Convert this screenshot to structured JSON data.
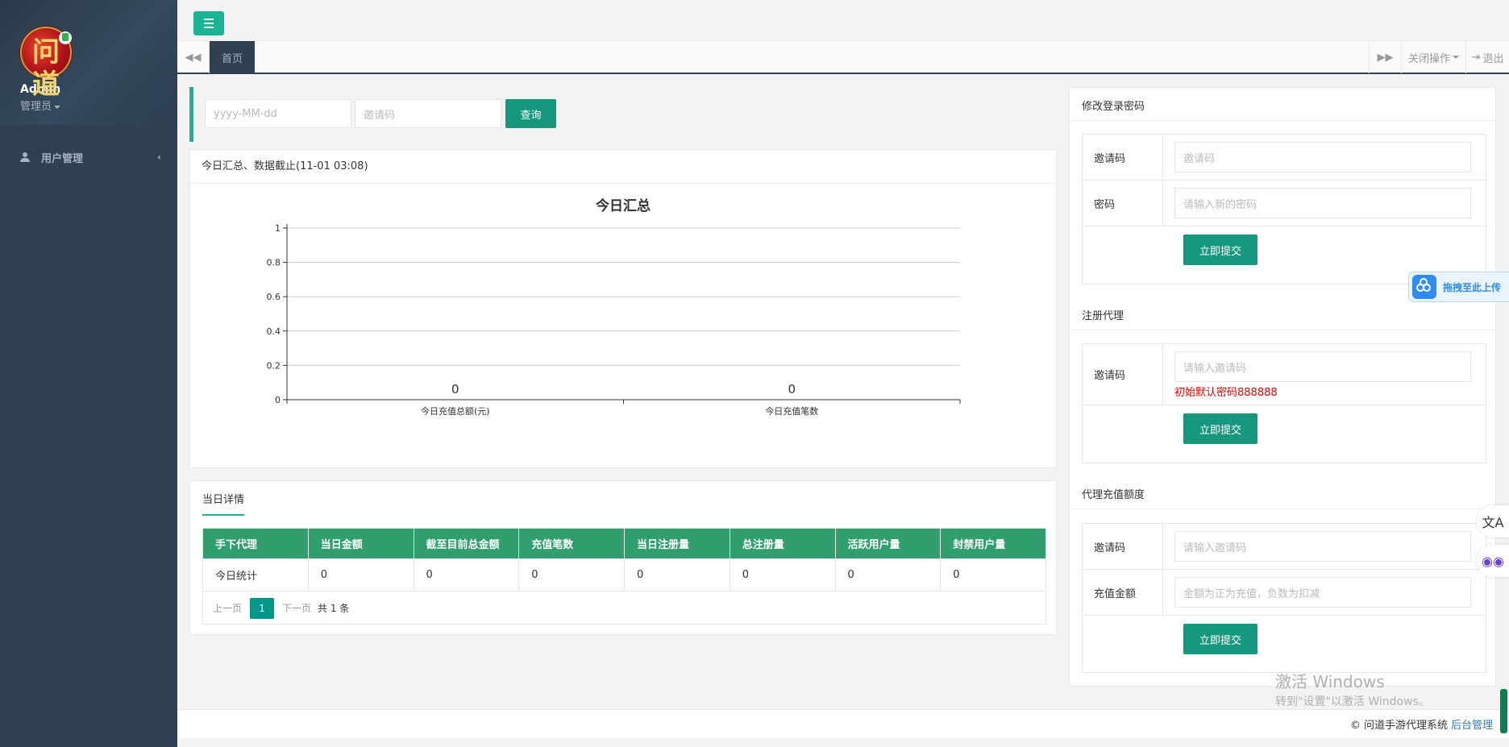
{
  "sidebar": {
    "user": {
      "name": "Admin",
      "role": "管理员",
      "avatar_text": "问道"
    },
    "items": [
      {
        "label": "用户管理",
        "icon": "user-icon"
      }
    ]
  },
  "tabs": {
    "home": "首页",
    "close_ops": "关闭操作",
    "logout": "退出"
  },
  "search": {
    "date_placeholder": "yyyy-MM-dd",
    "code_placeholder": "邀请码",
    "query_label": "查询"
  },
  "summary": {
    "panel_title": "今日汇总、数据截止(11-01 03:08)",
    "chart_title": "今日汇总"
  },
  "chart_data": {
    "type": "bar",
    "title": "今日汇总",
    "categories": [
      "今日充值总额(元)",
      "今日充值笔数"
    ],
    "values": [
      0,
      0
    ],
    "ylim": [
      0,
      1
    ],
    "yticks": [
      "0",
      "0.2",
      "0.4",
      "0.6",
      "0.8",
      "1"
    ],
    "grid": true
  },
  "details": {
    "tab_label": "当日详情",
    "columns": [
      "手下代理",
      "当日金额",
      "截至目前总金额",
      "充值笔数",
      "当日注册量",
      "总注册量",
      "活跃用户量",
      "封禁用户量"
    ],
    "rows": [
      [
        "今日统计",
        "0",
        "0",
        "0",
        "0",
        "0",
        "0",
        "0"
      ]
    ],
    "pager": {
      "prev": "上一页",
      "current": "1",
      "next": "下一页",
      "total": "共 1 条"
    }
  },
  "forms": {
    "change_password": {
      "title": "修改登录密码",
      "code_label": "邀请码",
      "code_placeholder": "邀请码",
      "password_label": "密码",
      "password_placeholder": "请输入新的密码",
      "submit": "立即提交"
    },
    "register_agent": {
      "title": "注册代理",
      "code_label": "邀请码",
      "code_placeholder": "请输入邀请码",
      "hint": "初始默认密码888888",
      "submit": "立即提交"
    },
    "recharge": {
      "title": "代理充值额度",
      "code_label": "邀请码",
      "code_placeholder": "请输入邀请码",
      "amount_label": "充值金额",
      "amount_placeholder": "金额为正为充值，负数为扣减",
      "submit": "立即提交"
    }
  },
  "footer": {
    "copyright": "© 问道手游代理系统",
    "link": "后台管理"
  },
  "overlays": {
    "upload": "拖拽至此上传",
    "watermark_title": "激活 Windows",
    "watermark_sub": "转到\"设置\"以激活 Windows。"
  },
  "colors": {
    "accent": "#1ab394",
    "sidebar": "#2f4050",
    "table_header": "#319e6d",
    "button": "#16987e",
    "hint": "#e00000"
  }
}
